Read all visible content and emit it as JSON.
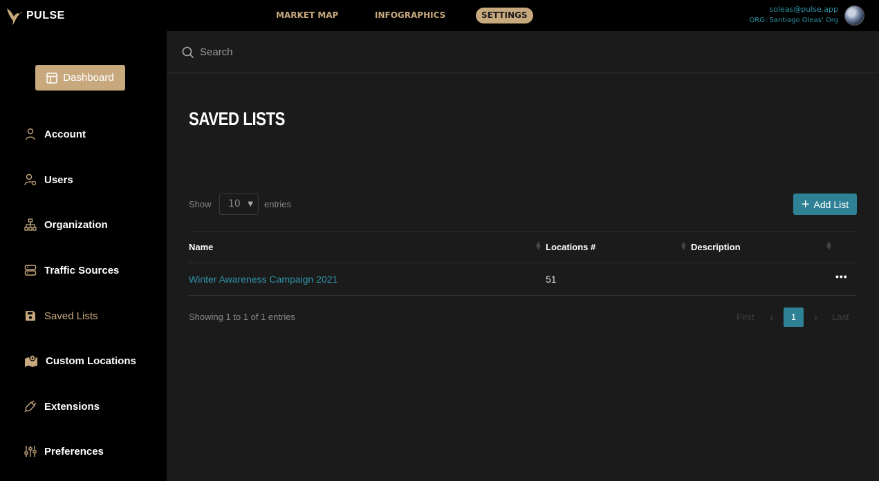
{
  "header": {
    "logo_text": "PULSE",
    "nav": [
      {
        "label": "MARKET MAP"
      },
      {
        "label": "INFOGRAPHICS"
      },
      {
        "label": "SETTINGS"
      }
    ],
    "user_email": "soleas@pulse.app",
    "user_org": "ORG: Santiago Oleas' Org"
  },
  "sidebar": {
    "dashboard_label": "Dashboard",
    "items": [
      {
        "label": "Account",
        "icon": "user-icon"
      },
      {
        "label": "Users",
        "icon": "users-icon"
      },
      {
        "label": "Organization",
        "icon": "org-chart-icon"
      },
      {
        "label": "Traffic Sources",
        "icon": "server-icon"
      },
      {
        "label": "Saved Lists",
        "icon": "save-icon"
      },
      {
        "label": "Custom Locations",
        "icon": "map-pin-icon"
      },
      {
        "label": "Extensions",
        "icon": "plug-icon"
      },
      {
        "label": "Preferences",
        "icon": "sliders-icon"
      }
    ]
  },
  "main": {
    "search_placeholder": "Search",
    "title": "SAVED LISTS",
    "show_label": "Show",
    "entries_value": "10",
    "entries_label": "entries",
    "add_button_label": "Add List",
    "table": {
      "columns": [
        "Name",
        "Locations #",
        "Description"
      ],
      "rows": [
        {
          "name": "Winter Awareness Campaign 2021",
          "locations": "51",
          "description": "",
          "actions": "•••"
        }
      ]
    },
    "info_text": "Showing 1 to 1 of 1 entries",
    "pagination": {
      "first": "First",
      "prev": "‹",
      "current": "1",
      "next": "›",
      "last": "Last"
    }
  },
  "colors": {
    "accent": "#c8a97e",
    "link": "#2f93a7",
    "button": "#2f8196"
  }
}
